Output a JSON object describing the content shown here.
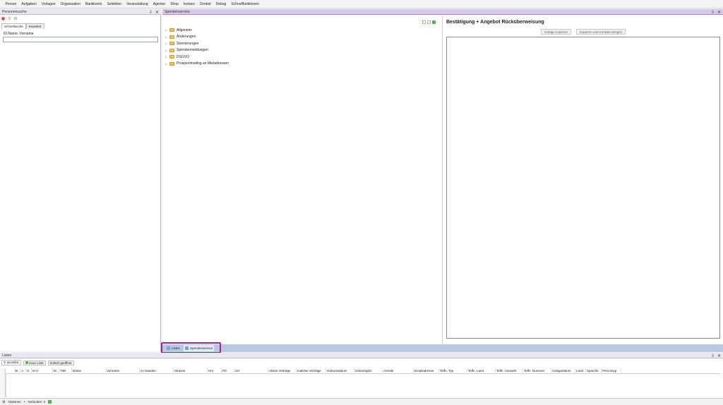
{
  "menu": [
    "Person",
    "Aufgaben",
    "Vorlagen",
    "Organisation",
    "Bankkonto",
    "Selektion",
    "Veranstaltung",
    "Agentur",
    "Shop",
    "Instanz",
    "Zentral",
    "Debug",
    "Schnellfunktionen"
  ],
  "left_panel": {
    "title": "Personensuche",
    "tabs": [
      "Schnellsuche",
      "Erweitert"
    ],
    "search_label": "ID,Name, Vorname",
    "search_value": ""
  },
  "center_panel": {
    "title": "Spendenservice",
    "tree": [
      "Allgemein",
      "Änderungen",
      "Stornierungen",
      "Spendenmeldungen",
      "DSGVO",
      "Prospectmailing an Mietadressen"
    ],
    "right_title": "Bestätigung + Angebot Rücküberweisung",
    "btn_copy": "Vorlage kopieren",
    "btn_copy_contact": "Kopieren und Kontakt anlegen"
  },
  "bottom_tabs": {
    "tab1": "Listen",
    "tab2": "Spendenservice"
  },
  "lists_panel": {
    "title": "Listen",
    "tabs": [
      "Quicklist",
      "neue Liste",
      "Zuletzt geöffnet"
    ],
    "columns": [
      "Nr.",
      "A",
      "G",
      "M X",
      "ID",
      "Titel",
      "Name",
      "Vorname",
      "zu Handen",
      "Strasse",
      "Hnr",
      "Plz",
      "Ort",
      "Aktive Verträge",
      "Inaktive Verträge",
      "Geburtsdatum",
      "Geburtsjahr",
      "Anrede",
      "Emailadresse",
      "Telfn. Typ",
      "Telfn. Land",
      "Telfn. Vorwahl",
      "Telfn. Nummer",
      "Anlagedatum",
      "Land",
      "Sprache",
      "Persontyp"
    ],
    "status_options": "Optionen",
    "status_found": "Gefunden: 0"
  },
  "colors": {
    "accent_purple": "#9b2c8a",
    "header_purple": "#d9c9e6",
    "strip_blue": "#b9c8e3"
  }
}
